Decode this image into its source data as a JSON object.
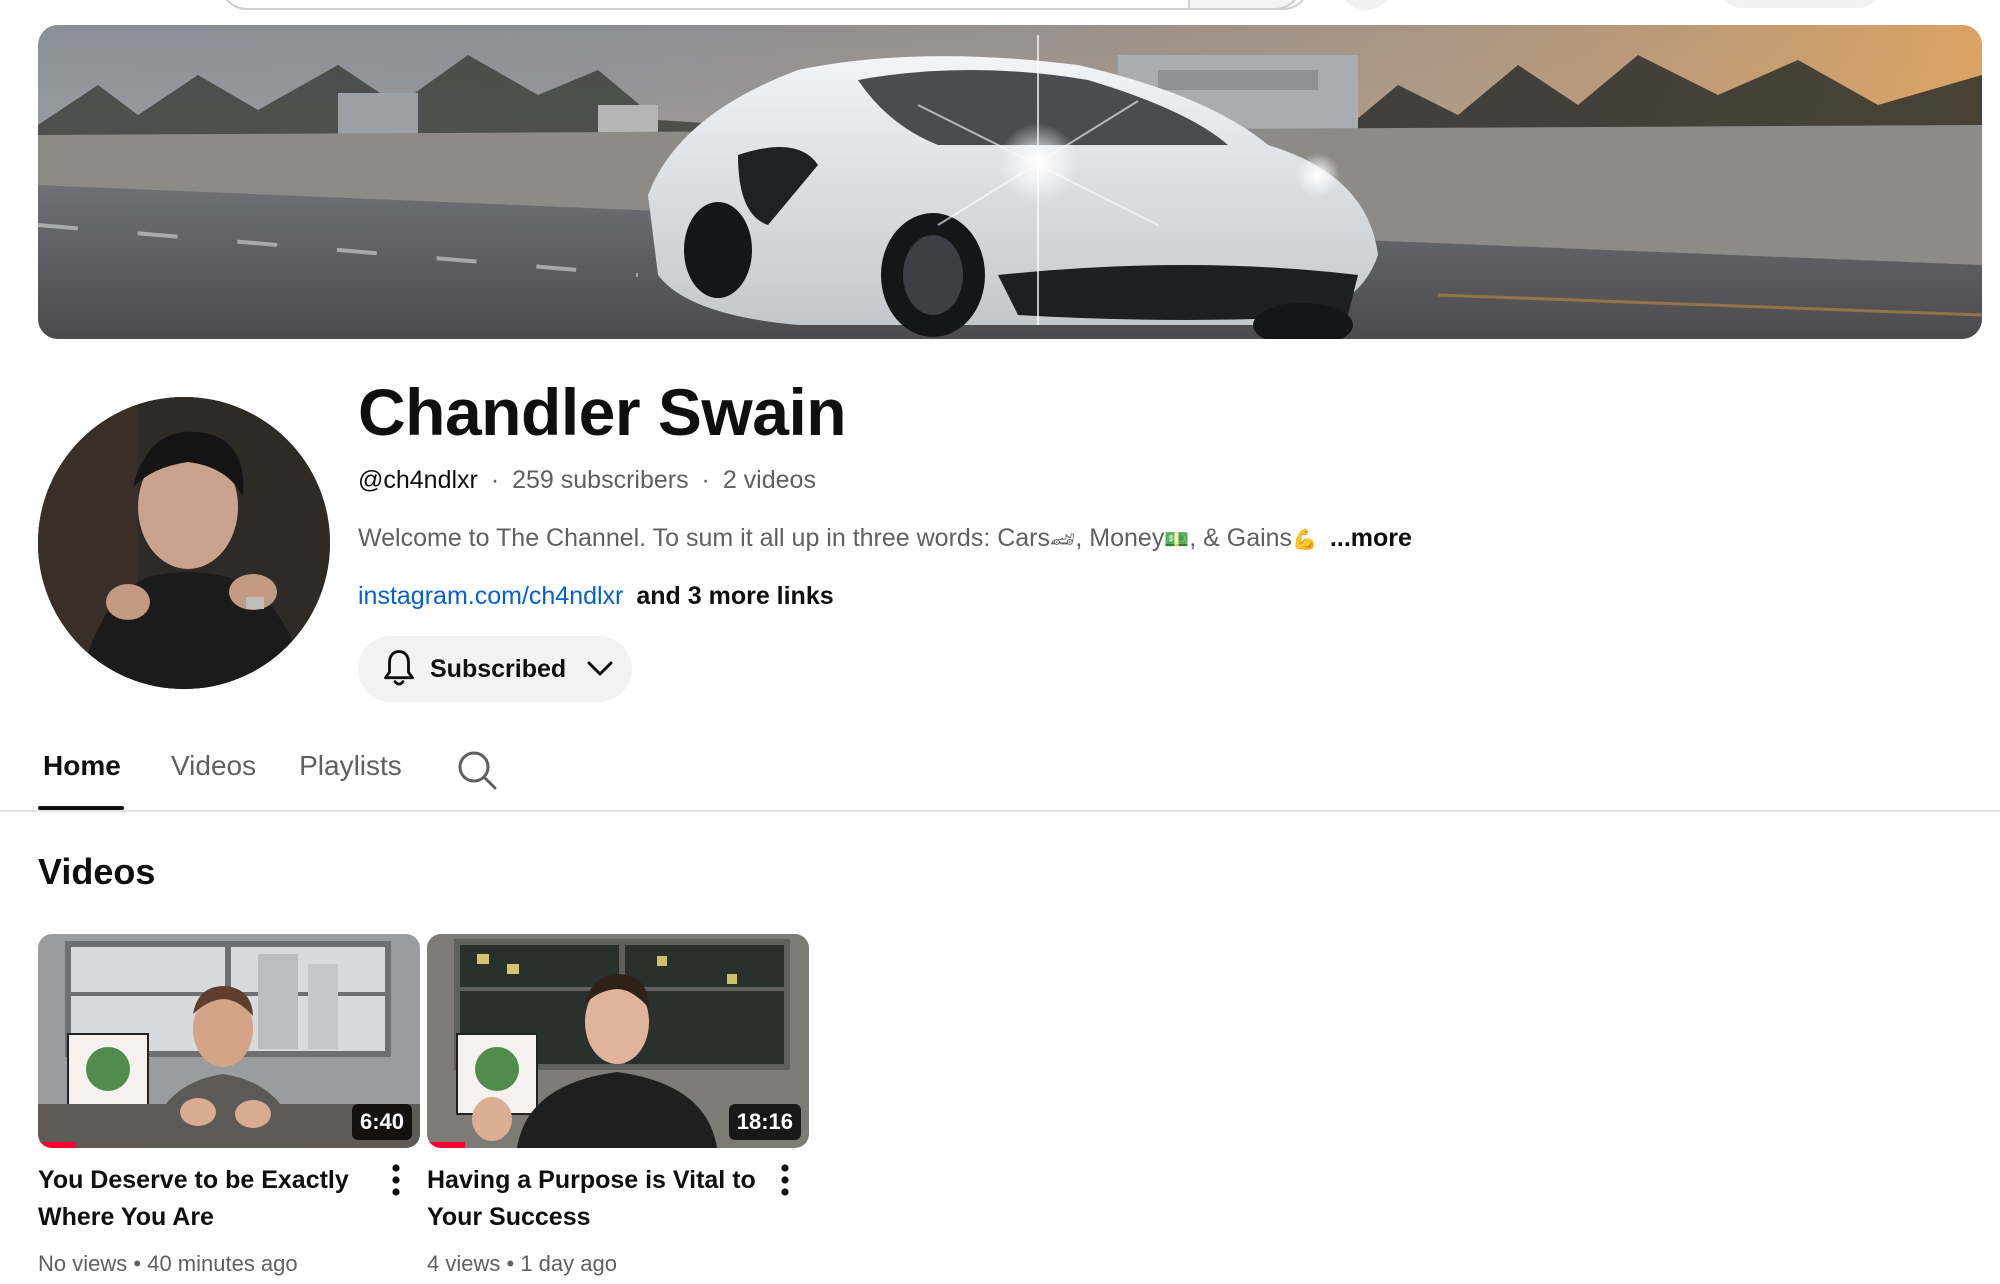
{
  "colors": {
    "link": "#065fd4",
    "secondary_text": "#606060",
    "progress_red": "#ff0033",
    "button_bg": "#f2f2f2"
  },
  "channel": {
    "name": "Chandler Swain",
    "handle": "@ch4ndlxr",
    "separator": "·",
    "subscribers": "259 subscribers",
    "video_count": "2 videos",
    "description": {
      "text_1": "Welcome to The Channel. To sum it all up in three words: Cars",
      "emoji_1": "🏎",
      "text_2": ", Money",
      "emoji_2": "💵",
      "text_3": ", & Gains",
      "emoji_3": "💪",
      "more": "...more"
    },
    "link": "instagram.com/ch4ndlxr",
    "more_links": "and 3 more links",
    "subscribe_button": {
      "label": "Subscribed",
      "icon": "bell-icon",
      "dropdown_icon": "chevron-down-icon"
    }
  },
  "tabs": [
    {
      "label": "Home",
      "active": true
    },
    {
      "label": "Videos",
      "active": false
    },
    {
      "label": "Playlists",
      "active": false
    }
  ],
  "tab_search_icon": "search-icon",
  "videos_section": {
    "title": "Videos",
    "items": [
      {
        "title": "You Deserve to be Exactly Where You Are",
        "duration": "6:40",
        "views": "No views",
        "age": "40 minutes ago",
        "watch_progress": 0.1
      },
      {
        "title": "Having a Purpose is Vital to Your Success",
        "duration": "18:16",
        "views": "4 views",
        "age": "1 day ago",
        "watch_progress": 0.1
      }
    ],
    "meta_separator": "•",
    "menu_icon": "more-vert-icon"
  }
}
